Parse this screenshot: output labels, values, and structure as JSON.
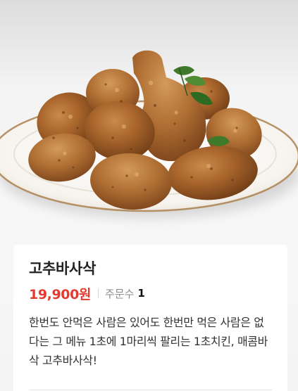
{
  "product": {
    "image_icon": "fried-chicken-photo",
    "name": "고추바사삭",
    "price": "19,900원",
    "order_label": "주문수",
    "order_count": "1",
    "description": "한번도 안먹은 사람은 있어도 한번만 먹은 사람은 없다는 그 메뉴 1초에 1마리씩 팔리는 1초치킨, 매콤바삭 고추바사삭!"
  },
  "colors": {
    "price": "#e33b30",
    "card_background": "#ffffff",
    "page_background": "#f4f4f4"
  }
}
